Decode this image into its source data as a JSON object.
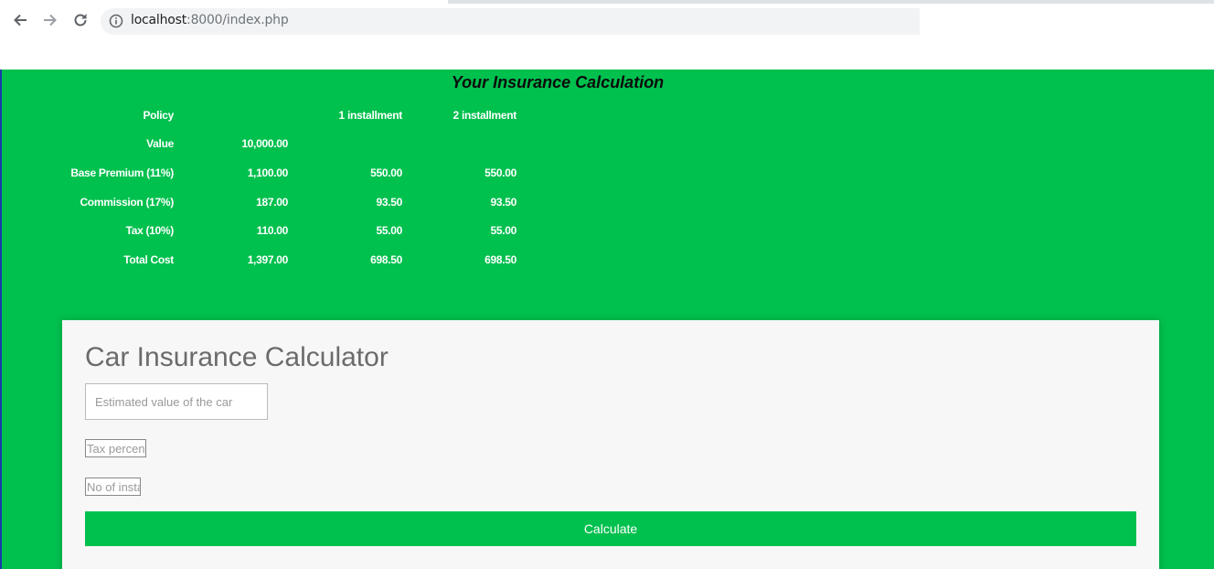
{
  "browser": {
    "url_host": "localhost",
    "url_rest": ":8000/index.php",
    "icons": [
      "back-arrow-icon",
      "forward-arrow-icon",
      "reload-icon",
      "info-icon"
    ]
  },
  "results": {
    "title": "Your Insurance Calculation",
    "headers": [
      "Policy",
      "",
      "1 installment",
      "2 installment"
    ],
    "rows": [
      [
        "Value",
        "10,000.00",
        "",
        ""
      ],
      [
        "Base Premium (11%)",
        "1,100.00",
        "550.00",
        "550.00"
      ],
      [
        "Commission (17%)",
        "187.00",
        "93.50",
        "93.50"
      ],
      [
        "Tax (10%)",
        "110.00",
        "55.00",
        "55.00"
      ],
      [
        "Total Cost",
        "1,397.00",
        "698.50",
        "698.50"
      ]
    ]
  },
  "form": {
    "title": "Car Insurance Calculator",
    "value_placeholder": "Estimated value of the car",
    "tax_placeholder": "Tax percentage",
    "installments_placeholder": "No of installments",
    "submit_label": "Calculate"
  },
  "colors": {
    "page_background": "#00c04e",
    "card_background": "#f7f7f7",
    "button": "#00c04e"
  }
}
